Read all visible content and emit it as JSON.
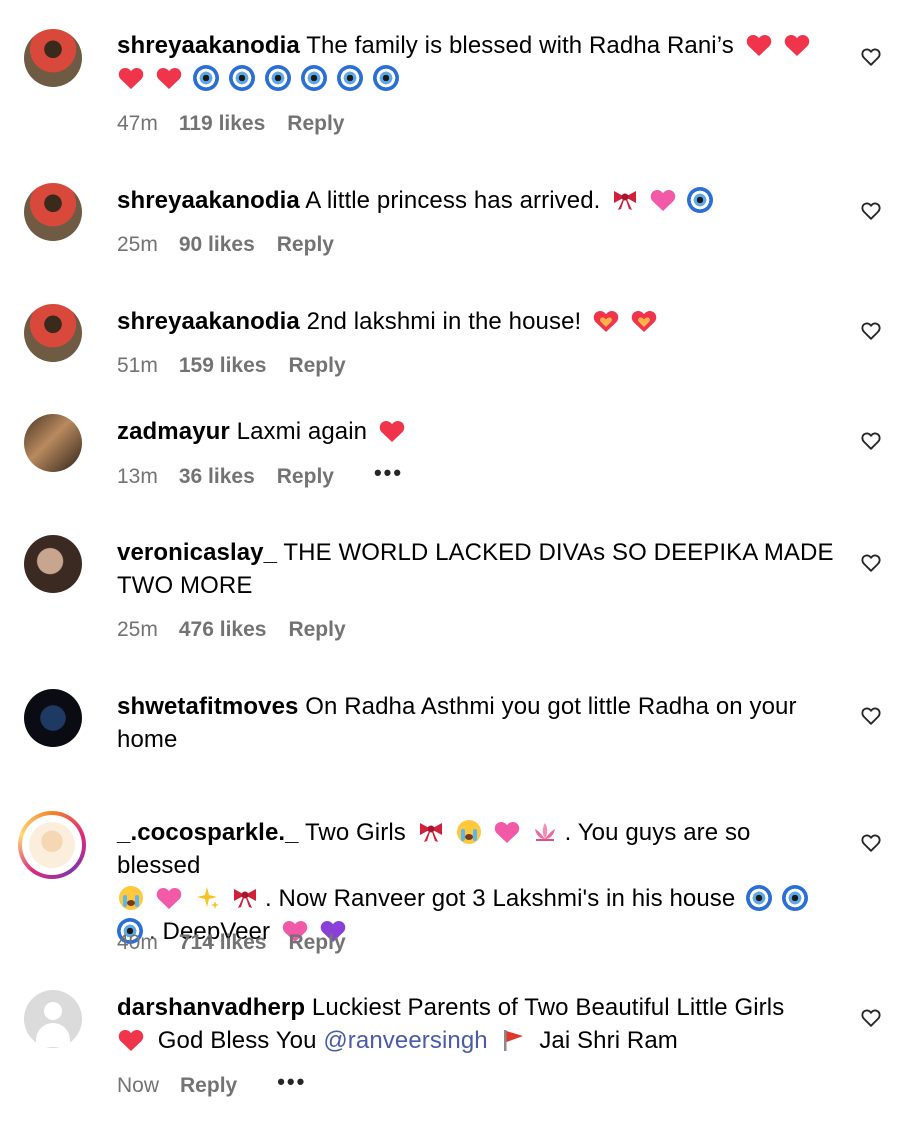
{
  "comments": [
    {
      "username": "shreyaakanodia",
      "text": "The family is blessed with Radha Rani’s",
      "text2": "",
      "time": "47m",
      "likes": "119 likes",
      "reply": "Reply",
      "emojis": [
        "red-heart",
        "red-heart",
        "red-heart",
        "red-heart",
        "evil-eye",
        "evil-eye",
        "evil-eye",
        "evil-eye",
        "evil-eye",
        "evil-eye"
      ]
    },
    {
      "username": "shreyaakanodia",
      "text": "A little princess has arrived.",
      "time": "25m",
      "likes": "90 likes",
      "reply": "Reply",
      "emojis": [
        "ribbon",
        "pink-heart",
        "evil-eye"
      ]
    },
    {
      "username": "shreyaakanodia",
      "text": "2nd lakshmi in the house!",
      "time": "51m",
      "likes": "159 likes",
      "reply": "Reply",
      "emojis": [
        "heart-on-fire",
        "heart-on-fire"
      ]
    },
    {
      "username": "zadmayur",
      "text": "Laxmi again",
      "time": "13m",
      "likes": "36 likes",
      "reply": "Reply",
      "more": "•••",
      "emojis": [
        "red-heart"
      ]
    },
    {
      "username": "veronicaslay_",
      "text": "THE WORLD LACKED DIVAs SO DEEPIKA MADE",
      "text_line2": "TWO MORE",
      "time": "25m",
      "likes": "476 likes",
      "reply": "Reply"
    },
    {
      "username": "shwetafitmoves",
      "text": "On Radha Asthmi you got little Radha on your",
      "text_line2": "home"
    },
    {
      "username": "_.cocosparkle._",
      "text_a": "Two Girls",
      "text_b": ". You guys are so blessed",
      "text_c": ". Now Ranveer got 3 Lakshmi's in his house",
      "text_d": ". DeepVeer",
      "time": "40m",
      "likes": "714 likes",
      "reply": "Reply"
    },
    {
      "username": "darshanvadherp",
      "text_a": "Luckiest Parents of Two Beautiful Little Girls",
      "text_b": "God Bless You",
      "mention": "@ranveersingh",
      "text_c": "Jai Shri Ram",
      "time": "Now",
      "reply": "Reply",
      "more": "•••"
    }
  ],
  "colors": {
    "meta_text": "#737373",
    "mention": "#4a5ca8",
    "red_heart": "#f0344b",
    "pink_heart": "#f25aa8",
    "purple_heart": "#8b3fd9"
  }
}
